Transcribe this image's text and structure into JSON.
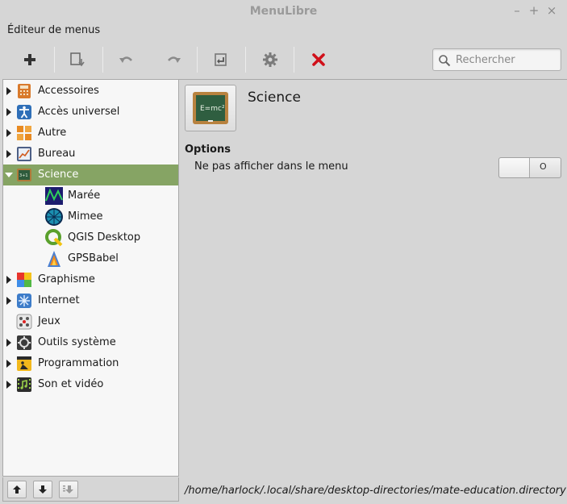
{
  "window": {
    "title": "MenuLibre"
  },
  "menubar": {
    "editor_menu": "Éditeur de menus"
  },
  "search": {
    "placeholder": "Rechercher",
    "value": ""
  },
  "tree": [
    {
      "label": "Accessoires",
      "icon": "accessories-icon",
      "expander": "collapsed",
      "level": 0,
      "selected": false
    },
    {
      "label": "Accès universel",
      "icon": "accessibility-icon",
      "expander": "collapsed",
      "level": 0,
      "selected": false
    },
    {
      "label": "Autre",
      "icon": "other-icon",
      "expander": "collapsed",
      "level": 0,
      "selected": false
    },
    {
      "label": "Bureau",
      "icon": "office-icon",
      "expander": "collapsed",
      "level": 0,
      "selected": false
    },
    {
      "label": "Science",
      "icon": "science-icon",
      "expander": "expanded",
      "level": 0,
      "selected": true
    },
    {
      "label": "Marée",
      "icon": "maree-icon",
      "expander": "none",
      "level": 1,
      "selected": false
    },
    {
      "label": "Mimee",
      "icon": "mimee-icon",
      "expander": "none",
      "level": 1,
      "selected": false
    },
    {
      "label": "QGIS Desktop",
      "icon": "qgis-icon",
      "expander": "none",
      "level": 1,
      "selected": false
    },
    {
      "label": "GPSBabel",
      "icon": "gpsbabel-icon",
      "expander": "none",
      "level": 1,
      "selected": false
    },
    {
      "label": "Graphisme",
      "icon": "graphics-icon",
      "expander": "collapsed",
      "level": 0,
      "selected": false
    },
    {
      "label": "Internet",
      "icon": "internet-icon",
      "expander": "collapsed",
      "level": 0,
      "selected": false
    },
    {
      "label": "Jeux",
      "icon": "games-icon",
      "expander": "none",
      "level": 0,
      "selected": false
    },
    {
      "label": "Outils système",
      "icon": "system-tools-icon",
      "expander": "collapsed",
      "level": 0,
      "selected": false
    },
    {
      "label": "Programmation",
      "icon": "programming-icon",
      "expander": "collapsed",
      "level": 0,
      "selected": false
    },
    {
      "label": "Son et vidéo",
      "icon": "multimedia-icon",
      "expander": "collapsed",
      "level": 0,
      "selected": false
    }
  ],
  "detail": {
    "title": "Science",
    "options_heading": "Options",
    "hide_option_label": "Ne pas afficher dans le menu",
    "hide_toggle_state": "O",
    "file_path": "/home/harlock/.local/share/desktop-directories/mate-education.directory"
  },
  "colors": {
    "selection": "#86a464",
    "delete": "#d0101a"
  }
}
